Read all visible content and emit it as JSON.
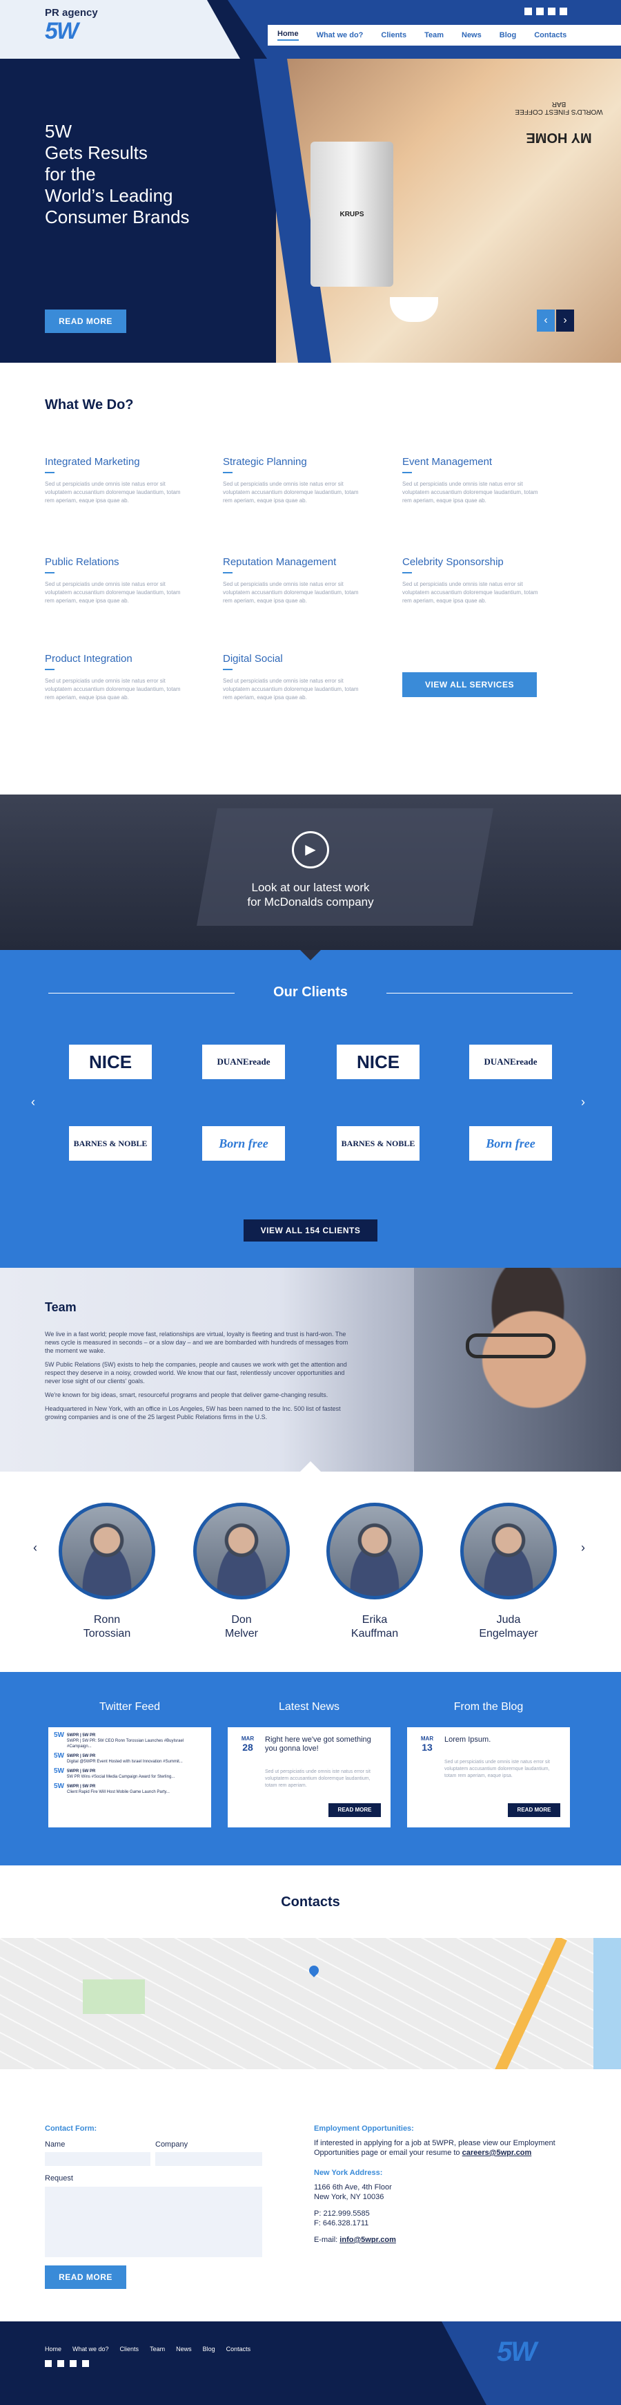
{
  "brand": {
    "tagline": "PR agency",
    "logo": "5W"
  },
  "social": [
    "twitter-icon",
    "facebook-icon",
    "linkedin-icon",
    "rss-icon"
  ],
  "nav": [
    {
      "label": "Home",
      "active": true
    },
    {
      "label": "What we do?"
    },
    {
      "label": "Clients"
    },
    {
      "label": "Team"
    },
    {
      "label": "News"
    },
    {
      "label": "Blog"
    },
    {
      "label": "Contacts"
    }
  ],
  "hero": {
    "line1": "5W",
    "line2": "Gets Results",
    "line3": "for the",
    "line4": "World’s Leading",
    "line5": "Consumer Brands",
    "button": "READ MORE",
    "machine_brand": "KRUPS",
    "sign_top": "MY HOME",
    "sign_bottom": "WORLD'S FINEST COFFEE BAR"
  },
  "what_we_do": {
    "title": "What We Do?",
    "lorem": "Sed ut perspiciatis unde omnis iste natus error sit voluptatem accusantium doloremque laudantium, totam rem aperiam, eaque ipsa quae ab.",
    "services": [
      "Integrated Marketing",
      "Strategic Planning",
      "Event Management",
      "Public Relations",
      "Reputation Management",
      "Celebrity Sponsorship",
      "Product Integration",
      "Digital Social"
    ],
    "button": "VIEW ALL SERVICES"
  },
  "video": {
    "line1": "Look at our latest work",
    "line2": "for McDonalds company"
  },
  "clients": {
    "title": "Our Clients",
    "logos": [
      "NICE",
      "DUANEreade",
      "NICE",
      "DUANEreade",
      "BARNES & NOBLE",
      "Born free",
      "BARNES & NOBLE",
      "Born free"
    ],
    "button": "VIEW ALL 154 CLIENTS"
  },
  "team": {
    "title": "Team",
    "p1": "We live in a fast world; people move fast, relationships are virtual, loyalty is fleeting and trust is hard-won. The news cycle is measured in seconds – or a slow day – and we are bombarded with hundreds of messages from the moment we wake.",
    "p2": "5W Public Relations (5W) exists to help the companies, people and causes we work with get the attention and respect they deserve in a noisy, crowded world. We know that our fast, relentlessly uncover opportunities and never lose sight of our clients' goals.",
    "p3": "We're known for big ideas, smart, resourceful programs and people that deliver game-changing results.",
    "p4": "Headquartered in New York, with an office in Los Angeles, 5W has been named to the Inc. 500 list of fastest growing companies and is one of the 25 largest Public Relations firms in the U.S.",
    "members": [
      {
        "first": "Ronn",
        "last": "Torossian"
      },
      {
        "first": "Don",
        "last": "Melver"
      },
      {
        "first": "Erika",
        "last": "Kauffman"
      },
      {
        "first": "Juda",
        "last": "Engelmayer"
      }
    ]
  },
  "feeds": {
    "twitter_title": "Twitter Feed",
    "news_title": "Latest News",
    "blog_title": "From the Blog",
    "tweets": [
      {
        "user": "5WPR | 5W PR",
        "text": "5WPR | 5W PR: 5W CEO Ronn Torossian Launches #BuyIsrael #Campaign..."
      },
      {
        "user": "5WPR | 5W PR",
        "text": "Digital @5WPR Event Hosted with Israel Innovation #Summit..."
      },
      {
        "user": "5WPR | 5W PR",
        "text": "5W PR Wins #Social Media Campaign Award for Sterling..."
      },
      {
        "user": "5WPR | 5W PR",
        "text": "Client Rapid Fire Will Host Mobile Game Launch Party..."
      }
    ],
    "news_month": "MAR",
    "news_day": "28",
    "news_title_text": "Right here we've got something you gonna love!",
    "news_text": "Sed ut perspiciatis unde omnis iste natus error sit voluptatem accusantium doloremque laudantium, totam rem aperiam.",
    "blog_month": "MAR",
    "blog_day": "13",
    "blog_title_text": "Lorem Ipsum.",
    "blog_text": "Sed ut perspiciatis unde omnis iste natus error sit voluptatem accusantium doloremque laudantium, totam rem aperiam, eaque ipsa.",
    "read_more": "READ MORE"
  },
  "contacts": {
    "title": "Contacts"
  },
  "form": {
    "title": "Contact Form:",
    "name_label": "Name",
    "company_label": "Company",
    "request_label": "Request",
    "button": "READ MORE"
  },
  "employment": {
    "title": "Employment Opportunities:",
    "text": "If interested in applying for a job at 5WPR, please view our Employment Opportunities page or email your resume to",
    "email": "careers@5wpr.com",
    "address_title": "New York Address:",
    "addr1": "1166 6th Ave, 4th Floor",
    "addr2": "New York, NY 10036",
    "phone": "P: 212.999.5585",
    "fax": "F: 646.328.1711",
    "email_label": "E-mail:",
    "email2": "info@5wpr.com"
  },
  "footer": {
    "links": [
      "Home",
      "What we do?",
      "Clients",
      "Team",
      "News",
      "Blog",
      "Contacts"
    ],
    "logo": "5W"
  },
  "colors": {
    "navy": "#0d1f4d",
    "blue": "#3a8bd8",
    "link": "#2f68b8"
  }
}
